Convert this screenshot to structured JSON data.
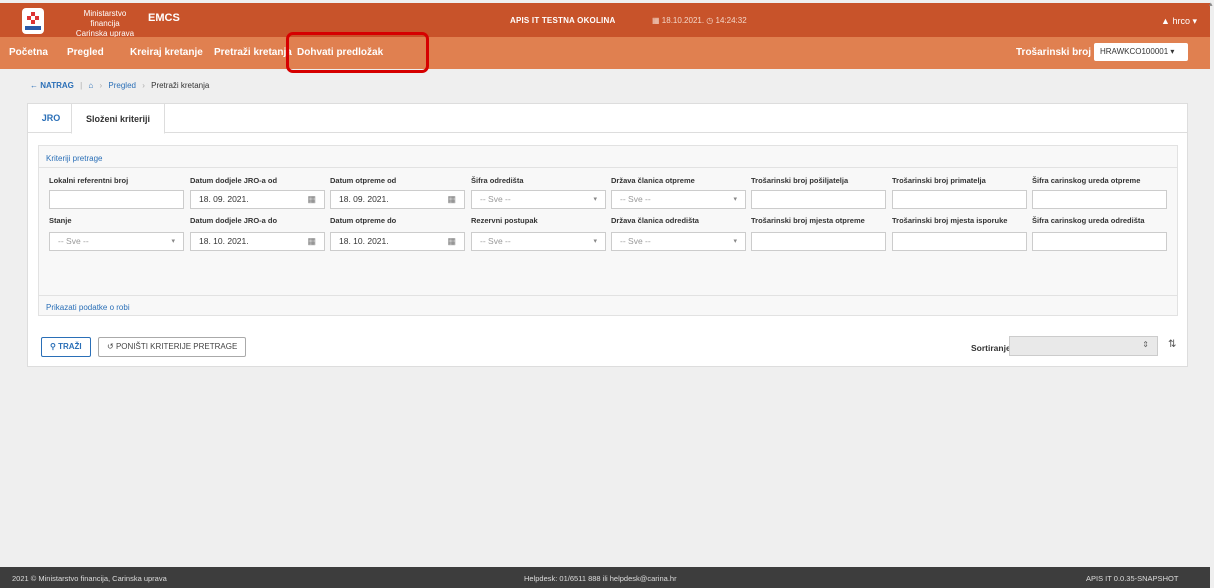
{
  "header": {
    "ministry_line1": "Ministarstvo financija",
    "ministry_line2": "Carinska uprava",
    "app_name": "EMCS",
    "environment": "APIS IT TESTNA OKOLINA",
    "date": "18.10.2021.",
    "time": "14:24:32",
    "user": "hrco",
    "brand_color": "#c8532a"
  },
  "nav": {
    "items": [
      "Početna",
      "Pregled",
      "Kreiraj kretanje",
      "Pretraži kretanja",
      "Dohvati predložak"
    ],
    "excise_label": "Trošarinski broj",
    "excise_value": "HRAWKCO100001"
  },
  "breadcrumb": {
    "back": "NATRAG",
    "level1": "Pregled",
    "current": "Pretraži kretanja"
  },
  "tabs": [
    "JRO",
    "Složeni kriteriji"
  ],
  "criteria": {
    "title": "Kriteriji pretrage",
    "row1": [
      {
        "label": "Lokalni referentni broj",
        "value": ""
      },
      {
        "label": "Datum dodjele JRO-a od",
        "value": "18. 09. 2021."
      },
      {
        "label": "Datum otpreme od",
        "value": "18. 09. 2021."
      },
      {
        "label": "Šifra odredišta",
        "value": "-- Sve --"
      },
      {
        "label": "Država članica otpreme",
        "value": "-- Sve --"
      },
      {
        "label": "Trošarinski broj pošiljatelja",
        "value": ""
      },
      {
        "label": "Trošarinski broj primatelja",
        "value": ""
      },
      {
        "label": "Šifra carinskog ureda otpreme",
        "value": ""
      }
    ],
    "row2": [
      {
        "label": "Stanje",
        "value": "-- Sve --"
      },
      {
        "label": "Datum dodjele JRO-a do",
        "value": "18. 10. 2021."
      },
      {
        "label": "Datum otpreme do",
        "value": "18. 10. 2021."
      },
      {
        "label": "Rezervni postupak",
        "value": "-- Sve --"
      },
      {
        "label": "Država članica odredišta",
        "value": "-- Sve --"
      },
      {
        "label": "Trošarinski broj mjesta otpreme",
        "value": ""
      },
      {
        "label": "Trošarinski broj mjesta isporuke",
        "value": ""
      },
      {
        "label": "Šifra carinskog ureda odredišta",
        "value": ""
      }
    ],
    "goods_link": "Prikazati podatke o robi"
  },
  "actions": {
    "search": "TRAŽI",
    "reset": "PONIŠTI KRITERIJE PRETRAGE",
    "sort_label": "Sortiranje"
  },
  "footer": {
    "left": "2021 © Ministarstvo financija, Carinska uprava",
    "center": "Helpdesk: 01/6511 888 ili helpdesk@carina.hr",
    "right": "APIS IT  0.0.35-SNAPSHOT"
  }
}
